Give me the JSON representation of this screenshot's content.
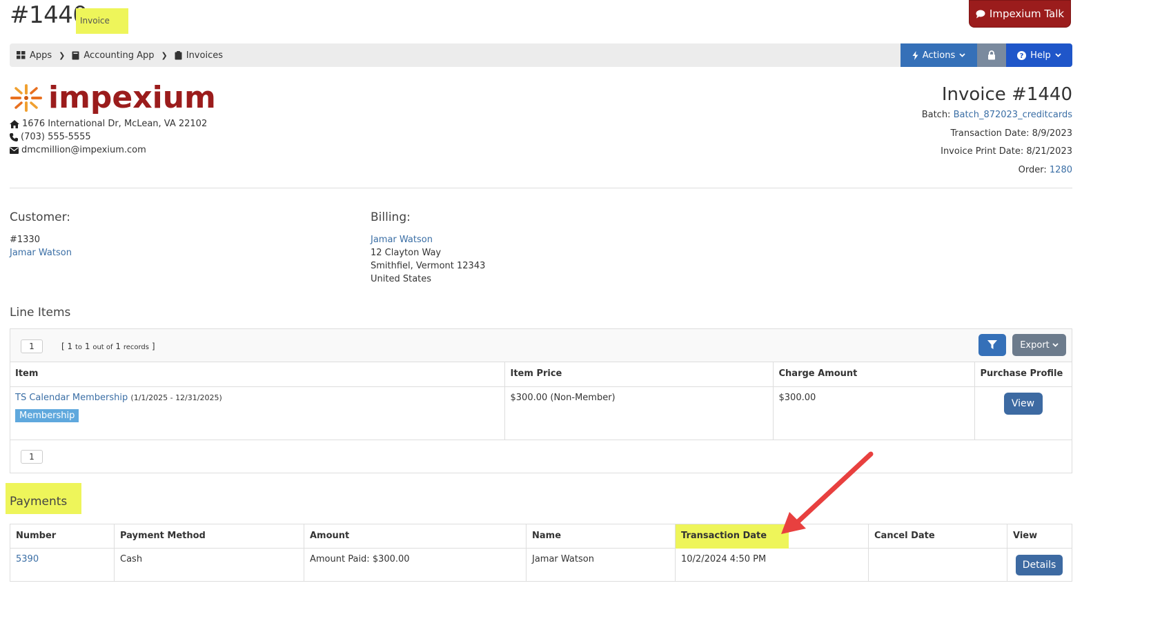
{
  "header": {
    "title": "#1440",
    "badge": "Invoice",
    "talk_label": "Impexium Talk"
  },
  "breadcrumb": {
    "items": [
      "Apps",
      "Accounting App",
      "Invoices"
    ],
    "actions_label": "Actions",
    "help_label": "Help"
  },
  "company": {
    "logo_text": "impexium",
    "address": "1676 International Dr, McLean, VA 22102",
    "phone": "(703) 555-5555",
    "email": "dmcmillion@impexium.com"
  },
  "invoice": {
    "title": "Invoice #1440",
    "batch_label": "Batch:",
    "batch_value": "Batch_872023_creditcards",
    "transaction_date": "Transaction Date: 8/9/2023",
    "print_date": "Invoice Print Date: 8/21/2023",
    "order_label": "Order:",
    "order_value": "1280"
  },
  "customer": {
    "label": "Customer:",
    "id": "#1330",
    "name": "Jamar Watson"
  },
  "billing": {
    "label": "Billing:",
    "name": "Jamar Watson",
    "street": "12 Clayton Way",
    "city": "Smithfiel, Vermont 12343",
    "country": "United States"
  },
  "line_items": {
    "label": "Line Items",
    "page": "1",
    "records_open": "[",
    "records_from": "1",
    "records_to_word": "to",
    "records_to": "1",
    "records_outof_word": "out of",
    "records_total": "1",
    "records_word": "records",
    "records_close": "]",
    "export_label": "Export",
    "columns": [
      "Item",
      "Item Price",
      "Charge Amount",
      "Purchase Profile"
    ],
    "row": {
      "item_name": "TS Calendar Membership",
      "item_dates": "(1/1/2025 - 12/31/2025)",
      "tag": "Membership",
      "price": "$300.00 (Non-Member)",
      "charge": "$300.00",
      "view_label": "View"
    },
    "footer_page": "1"
  },
  "payments": {
    "label": "Payments",
    "columns": [
      "Number",
      "Payment Method",
      "Amount",
      "Name",
      "Transaction Date",
      "Cancel Date",
      "View"
    ],
    "row": {
      "number": "5390",
      "method": "Cash",
      "amount": "Amount Paid: $300.00",
      "name": "Jamar Watson",
      "transaction_date": "10/2/2024 4:50 PM",
      "cancel_date": "",
      "details_label": "Details"
    }
  },
  "colors": {
    "brand": "#9b1c1c",
    "highlight": "#eef55a",
    "primary": "#3570b8",
    "link": "#3a6ea5",
    "arrow": "#e8403f"
  }
}
